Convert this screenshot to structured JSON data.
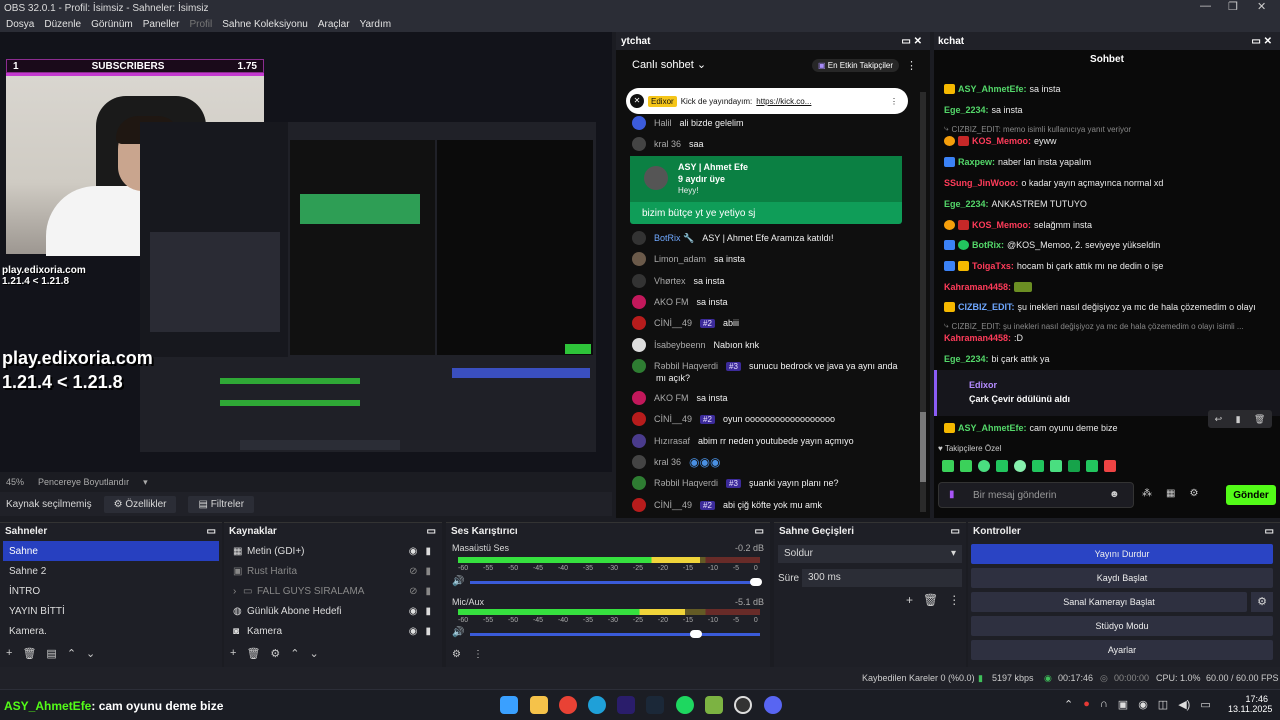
{
  "window": {
    "title": "OBS 32.0.1 - Profil: İsimsiz - Sahneler: İsimsiz"
  },
  "menu": [
    "Dosya",
    "Düzenle",
    "Görünüm",
    "Paneller",
    "Profil",
    "Sahne Koleksiyonu",
    "Araçlar",
    "Yardım"
  ],
  "preview": {
    "subscribers": {
      "left": "1",
      "label": "SUBSCRIBERS",
      "right": "1.75"
    },
    "overlay_small": "play.edixoria.com",
    "overlay_small_ver": "1.21.4 < 1.21.8",
    "overlay_big": "play.edixoria.com",
    "overlay_big_ver": "1.21.4 < 1.21.8",
    "zoom": "45%",
    "fit_label": "Pencereye Boyutlandır"
  },
  "source_bar": {
    "status": "Kaynak seçilmemiş",
    "properties": "Özellikler",
    "filters": "Filtreler"
  },
  "ytchat": {
    "dock_title": "ytchat",
    "header": "Canlı sohbet",
    "top_supporters": "En Etkin Takipçiler",
    "pinned": {
      "name": "Edixor",
      "text": "Kick de yayındayım:",
      "link": "https://kick.co..."
    },
    "membership": {
      "name": "ASY | Ahmet Efe",
      "months": "9 aydır üye",
      "hey": "Heyy!",
      "message": "bizim bütçe yt ye yetiyo sj"
    },
    "messages": [
      {
        "name": "Halil",
        "text": "ali bizde gelelim",
        "color": "#3b5bdb"
      },
      {
        "name": "kral 36",
        "text": "saa",
        "color": "#444"
      },
      {
        "name": "BotRix 🔧",
        "text": "ASY | Ahmet Efe Aramıza katıldı!",
        "color": "#333"
      },
      {
        "name": "Limon_adam",
        "text": "sa insta",
        "color": "#6b5a4a"
      },
      {
        "name": "Vhørtex",
        "text": "sa insta",
        "color": "#333"
      },
      {
        "name": "AKO FM",
        "text": "sa insta",
        "color": "#c2185b"
      },
      {
        "name": "CİNİ__49",
        "badge": "#2",
        "text": "abiii",
        "color": "#b71c1c"
      },
      {
        "name": "İsabeybeenn",
        "text": "Nabıon knk",
        "color": "#ddd"
      },
      {
        "name": "Rəbbil Haqverdi",
        "badge": "#3",
        "text": "sunucu bedrock ve java ya aynı anda",
        "text2": "mı açık?",
        "color": "#2e7d32"
      },
      {
        "name": "AKO FM",
        "text": "sa insta",
        "color": "#c2185b"
      },
      {
        "name": "CİNİ__49",
        "badge": "#2",
        "text": "oyun oooooooooooooooooo",
        "color": "#b71c1c"
      },
      {
        "name": "Hızırasaf",
        "text": "abim rr neden youtubede yayın açmıyo",
        "color": "#4a3b8c"
      },
      {
        "name": "kral 36",
        "text": "",
        "color": "#444"
      },
      {
        "name": "Rəbbil Haqverdi",
        "badge": "#3",
        "text": "şuanki yayın planı ne?",
        "color": "#2e7d32"
      },
      {
        "name": "CİNİ__49",
        "badge": "#2",
        "text": "abi çiğ köfte yok mu amk",
        "color": "#b71c1c"
      }
    ]
  },
  "kchat": {
    "dock_title": "kchat",
    "header": "Sohbet",
    "messages": [
      {
        "name": "ASY_AhmetEfe:",
        "text": "sa insta",
        "cls": "g"
      },
      {
        "name": "Ege_2234:",
        "text": "sa insta",
        "cls": "g"
      },
      {
        "reply": "CIZBIZ_EDIT: memo isimli kullanıcıya yanıt veriyor"
      },
      {
        "name": "KOS_Memoo:",
        "text": "eyww",
        "cls": "r"
      },
      {
        "name": "Raxpew:",
        "text": "naber lan insta yapalım",
        "cls": "g"
      },
      {
        "name": "SSung_JinWooo:",
        "text": "o kadar yayın açmayınca normal xd",
        "cls": "r"
      },
      {
        "name": "Ege_2234:",
        "text": "ANKASTREM TUTUYO",
        "cls": "g"
      },
      {
        "name": "KOS_Memoo:",
        "text": "selağmm insta",
        "cls": "r"
      },
      {
        "name": "BotRix:",
        "text": "@KOS_Memoo, 2. seviyeye yükseldin",
        "cls": "g"
      },
      {
        "name": "ToigaTxs:",
        "text": "hocam bi çark attık mı ne dedin o işe",
        "cls": "r"
      },
      {
        "name": "Kahraman4458:",
        "text": "",
        "cls": "r"
      },
      {
        "name": "CIZBIZ_EDIT:",
        "text": "şu inekleri nasıl değişiyoz ya mc de hala çözemedim o olayı",
        "cls": "b"
      },
      {
        "reply": "CIZBIZ_EDIT: şu inekleri nasıl değişiyoz ya mc de hala çözemedim o olayı isimli ..."
      },
      {
        "name": "Kahraman4458:",
        "text": ":D",
        "cls": "r"
      },
      {
        "name": "Ege_2234:",
        "text": "bi çark attık ya",
        "cls": "g"
      }
    ],
    "reward": {
      "name": "Edixor",
      "text": "Çark Çevir ödülünü aldı"
    },
    "last": {
      "name": "ASY_AhmetEfe:",
      "text": "cam oyunu deme bize"
    },
    "emote_label": "Takipçilere Özel",
    "input_placeholder": "Bir mesaj gönderin",
    "send": "Gönder"
  },
  "docks": {
    "scenes": {
      "title": "Sahneler",
      "items": [
        "Sahne",
        "Sahne 2",
        "İNTRO",
        "YAYIN BİTTİ",
        "Kamera."
      ]
    },
    "sources": {
      "title": "Kaynaklar",
      "items": [
        "Metin (GDI+)",
        "Rust Harita",
        "FALL GUYS SIRALAMA",
        "Günlük Abone Hedefi",
        "Kamera"
      ]
    },
    "mixer": {
      "title": "Ses Karıştırıcı",
      "ch1": {
        "name": "Masaüstü Ses",
        "db": "-0.2 dB",
        "level": 0.8
      },
      "ch2": {
        "name": "Mic/Aux",
        "db": "-5.1 dB",
        "level": 0.75
      },
      "ticks": [
        "-60",
        "-55",
        "-50",
        "-45",
        "-40",
        "-35",
        "-30",
        "-25",
        "-20",
        "-15",
        "-10",
        "-5",
        "0"
      ]
    },
    "transitions": {
      "title": "Sahne Geçişleri",
      "type": "Soldur",
      "duration_label": "Süre",
      "duration": "300 ms"
    },
    "controls": {
      "title": "Kontroller",
      "buttons": [
        "Yayını Durdur",
        "Kaydı Başlat",
        "Sanal Kamerayı Başlat",
        "Stüdyo Modu",
        "Ayarlar"
      ]
    }
  },
  "status": {
    "dropped": "Kaybedilen Kareler 0 (%0.0)",
    "kbps": "5197 kbps",
    "stream_time": "00:17:46",
    "rec_time": "00:00:00",
    "cpu": "CPU: 1.0%",
    "fps": "60.00 / 60.00 FPS"
  },
  "ticker": {
    "name": "ASY_AhmetEfe",
    "text": ": cam oyunu deme bize"
  },
  "clock": {
    "time": "17:46",
    "date": "13.11.2025"
  }
}
